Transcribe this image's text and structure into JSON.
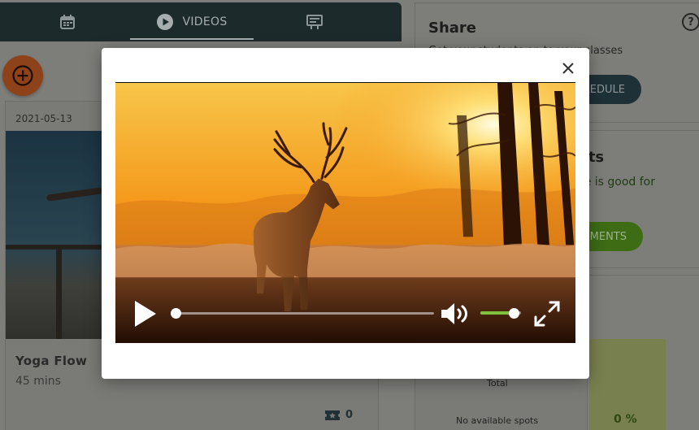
{
  "tabs": [
    {
      "label": "",
      "icon": "calendar-icon"
    },
    {
      "label": "VIDEOS",
      "icon": "play-circle-icon",
      "active": true
    },
    {
      "label": "",
      "icon": "board-icon"
    }
  ],
  "fab": {
    "icon": "plus-circle-icon",
    "color": "#e46a28"
  },
  "video_card": {
    "date": "2021-05-13",
    "title": "Yoga Flow",
    "duration": "45 mins",
    "ticket_count": "0"
  },
  "share_panel": {
    "title": "Share",
    "subtitle": "Get your students on to your classes",
    "button_label": "EDULE",
    "help_icon_label": "?"
  },
  "comments_panel": {
    "title": "nts",
    "text": "ce is good for",
    "button_label": "MENTS",
    "accent": "#7ec43a"
  },
  "stats_panel": {
    "total_label": "Total",
    "spots_label": "No available spots",
    "percent": "0 %"
  },
  "modal": {
    "close_icon": "close-icon",
    "video": {
      "progress": 0,
      "volume": 0.82,
      "volume_color": "#7ec43a",
      "icons": [
        "play-icon",
        "volume-icon",
        "fullscreen-icon"
      ]
    }
  }
}
